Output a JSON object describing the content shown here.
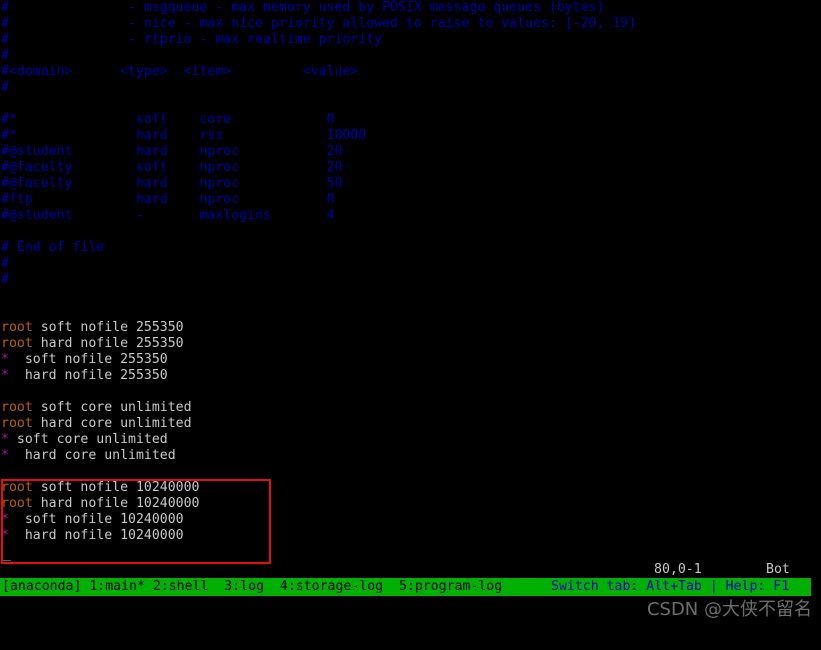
{
  "terminal": {
    "background": "#000000",
    "foreground": "#c8c8c8",
    "comment_color": "#0000a8",
    "root_color": "#c06000",
    "star_color": "#a020a0",
    "highlight_color": "#e01010",
    "statusbar_bg": "#00b000"
  },
  "editor": {
    "lines": [
      {
        "id": "l01",
        "segments": [
          {
            "cls": "c-comment",
            "text": "#\t\t- msgqueue - max memory used by POSIX message queues (bytes)"
          }
        ]
      },
      {
        "id": "l02",
        "segments": [
          {
            "cls": "c-comment",
            "text": "#\t\t- nice - max nice priority allowed to raise to values: [-20, 19]"
          }
        ]
      },
      {
        "id": "l03",
        "segments": [
          {
            "cls": "c-comment",
            "text": "#\t\t- rtprio - max realtime priority"
          }
        ]
      },
      {
        "id": "l04",
        "segments": [
          {
            "cls": "c-comment",
            "text": "#"
          }
        ]
      },
      {
        "id": "l05",
        "segments": [
          {
            "cls": "c-comment",
            "text": "#<domain>      <type>  <item>         <value>"
          }
        ]
      },
      {
        "id": "l06",
        "segments": [
          {
            "cls": "c-comment",
            "text": "#"
          }
        ]
      },
      {
        "id": "l07",
        "segments": [
          {
            "cls": "c-blank",
            "text": " "
          }
        ]
      },
      {
        "id": "l08",
        "segments": [
          {
            "cls": "c-comment",
            "text": "#*               soft    core            0"
          }
        ]
      },
      {
        "id": "l09",
        "segments": [
          {
            "cls": "c-comment",
            "text": "#*               hard    rss             10000"
          }
        ]
      },
      {
        "id": "l10",
        "segments": [
          {
            "cls": "c-comment",
            "text": "#@student        hard    nproc           20"
          }
        ]
      },
      {
        "id": "l11",
        "segments": [
          {
            "cls": "c-comment",
            "text": "#@faculty        soft    nproc           20"
          }
        ]
      },
      {
        "id": "l12",
        "segments": [
          {
            "cls": "c-comment",
            "text": "#@faculty        hard    nproc           50"
          }
        ]
      },
      {
        "id": "l13",
        "segments": [
          {
            "cls": "c-comment",
            "text": "#ftp             hard    nproc           0"
          }
        ]
      },
      {
        "id": "l14",
        "segments": [
          {
            "cls": "c-comment",
            "text": "#@student        -       maxlogins       4"
          }
        ]
      },
      {
        "id": "l15",
        "segments": [
          {
            "cls": "c-blank",
            "text": " "
          }
        ]
      },
      {
        "id": "l16",
        "segments": [
          {
            "cls": "c-comment",
            "text": "# End of file"
          }
        ]
      },
      {
        "id": "l17",
        "segments": [
          {
            "cls": "c-comment",
            "text": "#"
          }
        ]
      },
      {
        "id": "l18",
        "segments": [
          {
            "cls": "c-comment",
            "text": "#"
          }
        ]
      },
      {
        "id": "l19",
        "segments": [
          {
            "cls": "c-blank",
            "text": " "
          }
        ]
      },
      {
        "id": "l20",
        "segments": [
          {
            "cls": "c-blank",
            "text": " "
          }
        ]
      },
      {
        "id": "l21",
        "segments": [
          {
            "cls": "c-root",
            "text": "root"
          },
          {
            "cls": "c-text",
            "text": " soft nofile 255350"
          }
        ]
      },
      {
        "id": "l22",
        "segments": [
          {
            "cls": "c-root",
            "text": "root"
          },
          {
            "cls": "c-text",
            "text": " hard nofile 255350"
          }
        ]
      },
      {
        "id": "l23",
        "segments": [
          {
            "cls": "c-star",
            "text": "*"
          },
          {
            "cls": "c-text",
            "text": "  soft nofile 255350"
          }
        ]
      },
      {
        "id": "l24",
        "segments": [
          {
            "cls": "c-star",
            "text": "*"
          },
          {
            "cls": "c-text",
            "text": "  hard nofile 255350"
          }
        ]
      },
      {
        "id": "l25",
        "segments": [
          {
            "cls": "c-blank",
            "text": " "
          }
        ]
      },
      {
        "id": "l26",
        "segments": [
          {
            "cls": "c-root",
            "text": "root"
          },
          {
            "cls": "c-text",
            "text": " soft core unlimited"
          }
        ]
      },
      {
        "id": "l27",
        "segments": [
          {
            "cls": "c-root",
            "text": "root"
          },
          {
            "cls": "c-text",
            "text": " hard core unlimited"
          }
        ]
      },
      {
        "id": "l28",
        "segments": [
          {
            "cls": "c-star",
            "text": "*"
          },
          {
            "cls": "c-text",
            "text": " soft core unlimited"
          }
        ]
      },
      {
        "id": "l29",
        "segments": [
          {
            "cls": "c-star",
            "text": "*"
          },
          {
            "cls": "c-text",
            "text": "  hard core unlimited"
          }
        ]
      },
      {
        "id": "l30",
        "segments": [
          {
            "cls": "c-blank",
            "text": " "
          }
        ]
      },
      {
        "id": "l31",
        "segments": [
          {
            "cls": "c-root",
            "text": "root"
          },
          {
            "cls": "c-text",
            "text": " soft nofile 10240000"
          }
        ]
      },
      {
        "id": "l32",
        "segments": [
          {
            "cls": "c-root",
            "text": "root"
          },
          {
            "cls": "c-text",
            "text": " hard nofile 10240000"
          }
        ]
      },
      {
        "id": "l33",
        "segments": [
          {
            "cls": "c-star",
            "text": "*"
          },
          {
            "cls": "c-text",
            "text": "  soft nofile 10240000"
          }
        ]
      },
      {
        "id": "l34",
        "segments": [
          {
            "cls": "c-star",
            "text": "*"
          },
          {
            "cls": "c-text",
            "text": "  hard nofile 10240000"
          }
        ]
      }
    ],
    "cursor_glyph": "_"
  },
  "ruler": {
    "position": "80,0-1",
    "scroll_state": "Bot"
  },
  "statusbar": {
    "left_text": "[anaconda] 1:main* 2:shell  3:log  4:storage-log  5:program-log",
    "right_text": "Switch tab: Alt+Tab | Help: F1",
    "tabs": [
      {
        "index": "1",
        "label": "main",
        "active": true
      },
      {
        "index": "2",
        "label": "shell",
        "active": false
      },
      {
        "index": "3",
        "label": "log",
        "active": false
      },
      {
        "index": "4",
        "label": "storage-log",
        "active": false
      },
      {
        "index": "5",
        "label": "program-log",
        "active": false
      }
    ],
    "session_name": "[anaconda]"
  },
  "watermark": {
    "text": "CSDN @大侠不留名"
  }
}
